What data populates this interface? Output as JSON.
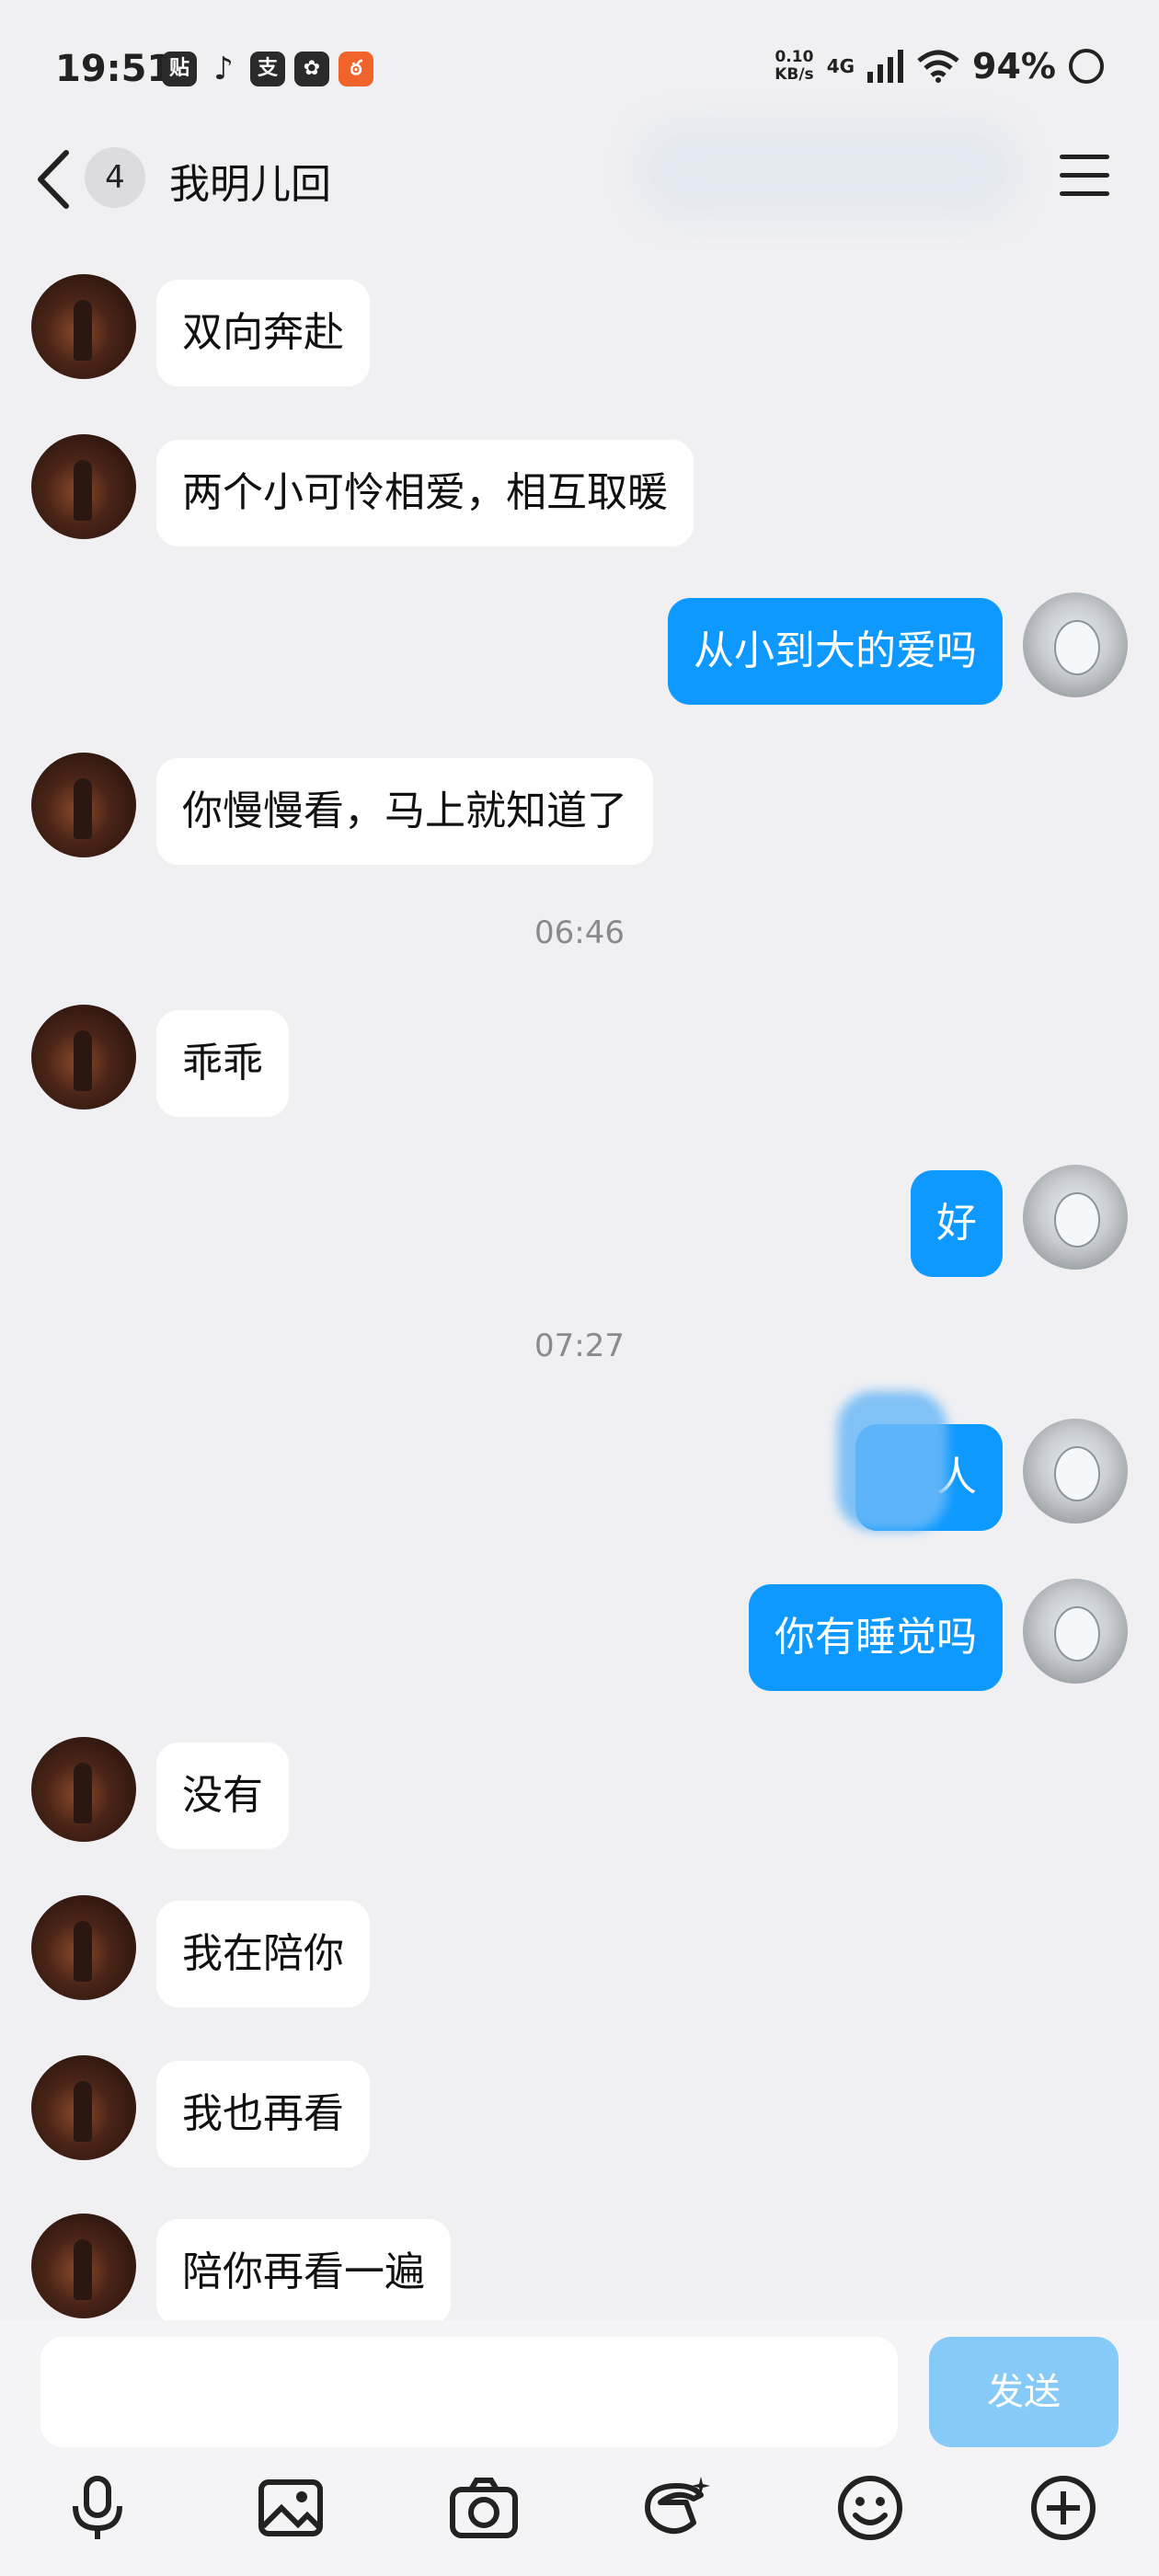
{
  "status_bar": {
    "time": "19:51",
    "app_icons": [
      "贴",
      "♪",
      "支",
      "✿",
      "ఠ"
    ],
    "speed_value": "0.10",
    "speed_unit": "KB/s",
    "network": "4G",
    "battery": "94%"
  },
  "header": {
    "back_icon": "chevron-left-icon",
    "unread_count": "4",
    "title": "我明儿回",
    "menu_icon": "hamburger-menu-icon"
  },
  "messages": [
    {
      "from": "other",
      "text": "双向奔赴"
    },
    {
      "from": "other",
      "text": "两个小可怜相爱，相互取暖"
    },
    {
      "from": "self",
      "text": "从小到大的爱吗"
    },
    {
      "from": "other",
      "text": "你慢慢看，马上就知道了"
    },
    {
      "from": "other",
      "text": "乖乖"
    },
    {
      "from": "self",
      "text": "好"
    },
    {
      "from": "self",
      "text": "人"
    },
    {
      "from": "self",
      "text": "你有睡觉吗"
    },
    {
      "from": "other",
      "text": "没有"
    },
    {
      "from": "other",
      "text": "我在陪你"
    },
    {
      "from": "other",
      "text": "我也再看"
    },
    {
      "from": "other",
      "text": "陪你再看一遍"
    }
  ],
  "timestamps": [
    "06:46",
    "07:27"
  ],
  "composer": {
    "input_value": "",
    "send_label": "发送",
    "send_color": "#86cbf8",
    "toolbar_icons": [
      "microphone-icon",
      "image-icon",
      "camera-icon",
      "sticker-icon",
      "emoji-icon",
      "plus-icon"
    ]
  },
  "colors": {
    "outgoing_bubble": "#0d99ff",
    "incoming_bubble": "#ffffff",
    "background": "#f0f0f3"
  }
}
